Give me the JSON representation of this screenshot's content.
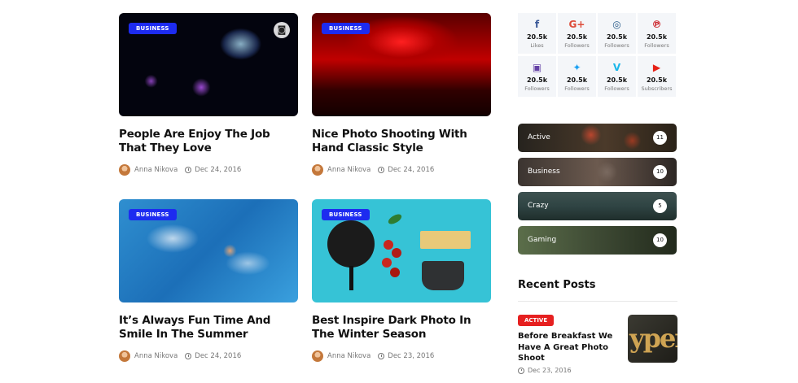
{
  "posts": [
    {
      "category": "BUSINESS",
      "title": "People Are Enjoy The Job That They Love",
      "author": "Anna Nikova",
      "date": "Dec 24, 2016"
    },
    {
      "category": "BUSINESS",
      "title": "Nice Photo Shooting With Hand Classic Style",
      "author": "Anna Nikova",
      "date": "Dec 24, 2016"
    },
    {
      "category": "BUSINESS",
      "title": "It’s Always Fun Time And Smile In The Summer",
      "author": "Anna Nikova",
      "date": "Dec 24, 2016"
    },
    {
      "category": "BUSINESS",
      "title": "Best Inspire Dark Photo In The Winter Season",
      "author": "Anna Nikova",
      "date": "Dec 23, 2016"
    }
  ],
  "social": [
    {
      "icon": "facebook-icon",
      "glyph": "f",
      "color": "#3b5998",
      "count": "20.5k",
      "label": "Likes"
    },
    {
      "icon": "google-plus-icon",
      "glyph": "G+",
      "color": "#dd4b39",
      "count": "20.5k",
      "label": "Followers"
    },
    {
      "icon": "instagram-icon",
      "glyph": "◎",
      "color": "#2a5c8a",
      "count": "20.5k",
      "label": "Followers"
    },
    {
      "icon": "pinterest-icon",
      "glyph": "℗",
      "color": "#cb2027",
      "count": "20.5k",
      "label": "Followers"
    },
    {
      "icon": "twitch-icon",
      "glyph": "▣",
      "color": "#6441a5",
      "count": "20.5k",
      "label": "Followers"
    },
    {
      "icon": "twitter-icon",
      "glyph": "✦",
      "color": "#1da1f2",
      "count": "20.5k",
      "label": "Followers"
    },
    {
      "icon": "vimeo-icon",
      "glyph": "V",
      "color": "#1ab7ea",
      "count": "20.5k",
      "label": "Followers"
    },
    {
      "icon": "youtube-icon",
      "glyph": "▶",
      "color": "#e62117",
      "count": "20.5k",
      "label": "Subscribers"
    }
  ],
  "categories": [
    {
      "label": "Active",
      "count": "11"
    },
    {
      "label": "Business",
      "count": "10"
    },
    {
      "label": "Crazy",
      "count": "5"
    },
    {
      "label": "Gaming",
      "count": "10"
    }
  ],
  "recent": {
    "heading": "Recent Posts",
    "badge": "ACTIVE",
    "title": "Before Breakfast We Have A Great Photo Shoot",
    "date": "Dec 23, 2016",
    "thumb_text": "yper"
  }
}
